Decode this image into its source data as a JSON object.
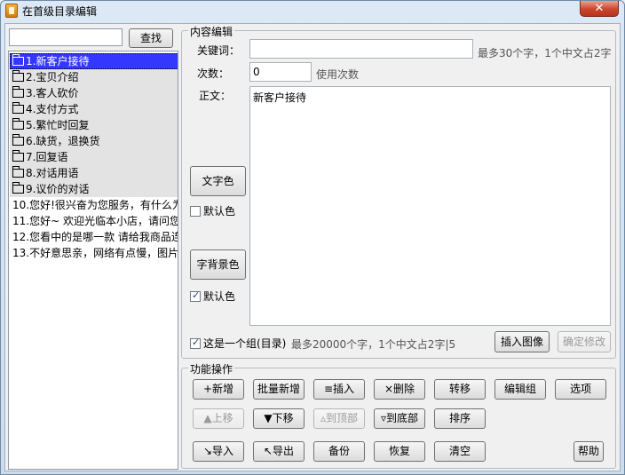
{
  "window": {
    "title": "在首级目录编辑",
    "close_label": "✕"
  },
  "left": {
    "search_value": "",
    "search_button": "查找",
    "items": [
      {
        "label": "1.新客户接待",
        "group": true,
        "selected": true
      },
      {
        "label": "2.宝贝介绍",
        "group": true
      },
      {
        "label": "3.客人砍价",
        "group": true
      },
      {
        "label": "4.支付方式",
        "group": true
      },
      {
        "label": "5.繁忙时回复",
        "group": true
      },
      {
        "label": "6.缺货，退换货",
        "group": true
      },
      {
        "label": "7.回复语",
        "group": true
      },
      {
        "label": "8.对话用语",
        "group": true
      },
      {
        "label": "9.议价的对话",
        "group": true
      },
      {
        "label": "10.您好!很兴奋为您服务，有什么为",
        "group": false
      },
      {
        "label": "11.您好~ 欢迎光临本小店，请问您",
        "group": false
      },
      {
        "label": "12.您看中的是哪一款 请给我商品连",
        "group": false
      },
      {
        "label": "13.不好意思亲，网络有点慢，图片",
        "group": false
      }
    ]
  },
  "content_edit": {
    "legend": "内容编辑",
    "keyword_label": "关键词：",
    "keyword_value": "",
    "keyword_hint": "最多30个字，1个中文占2字",
    "count_label": "次数：",
    "count_value": "0",
    "count_hint": "使用次数",
    "body_label": "正文：",
    "body_value": "新客户接待",
    "text_color_button": "文字色",
    "default_color_1": "默认色",
    "default_color_1_checked": false,
    "bg_color_button": "字背景色",
    "default_color_2": "默认色",
    "default_color_2_checked": true,
    "is_group_label": "这是一个组(目录)",
    "is_group_checked": true,
    "body_hint": "最多20000个字，1个中文占2字|5",
    "insert_image_button": "插入图像",
    "confirm_button": "确定修改"
  },
  "functions": {
    "legend": "功能操作",
    "row1": [
      "+新增",
      "批量新增",
      "≡插入",
      "×删除",
      "转移",
      "编辑组",
      "选项"
    ],
    "row2": [
      "▲上移",
      "▼下移",
      "▵到顶部",
      "▿到底部",
      "排序"
    ],
    "row3": [
      "↘导入",
      "↖导出",
      "备份",
      "恢复",
      "清空"
    ],
    "help_button": "帮助"
  }
}
